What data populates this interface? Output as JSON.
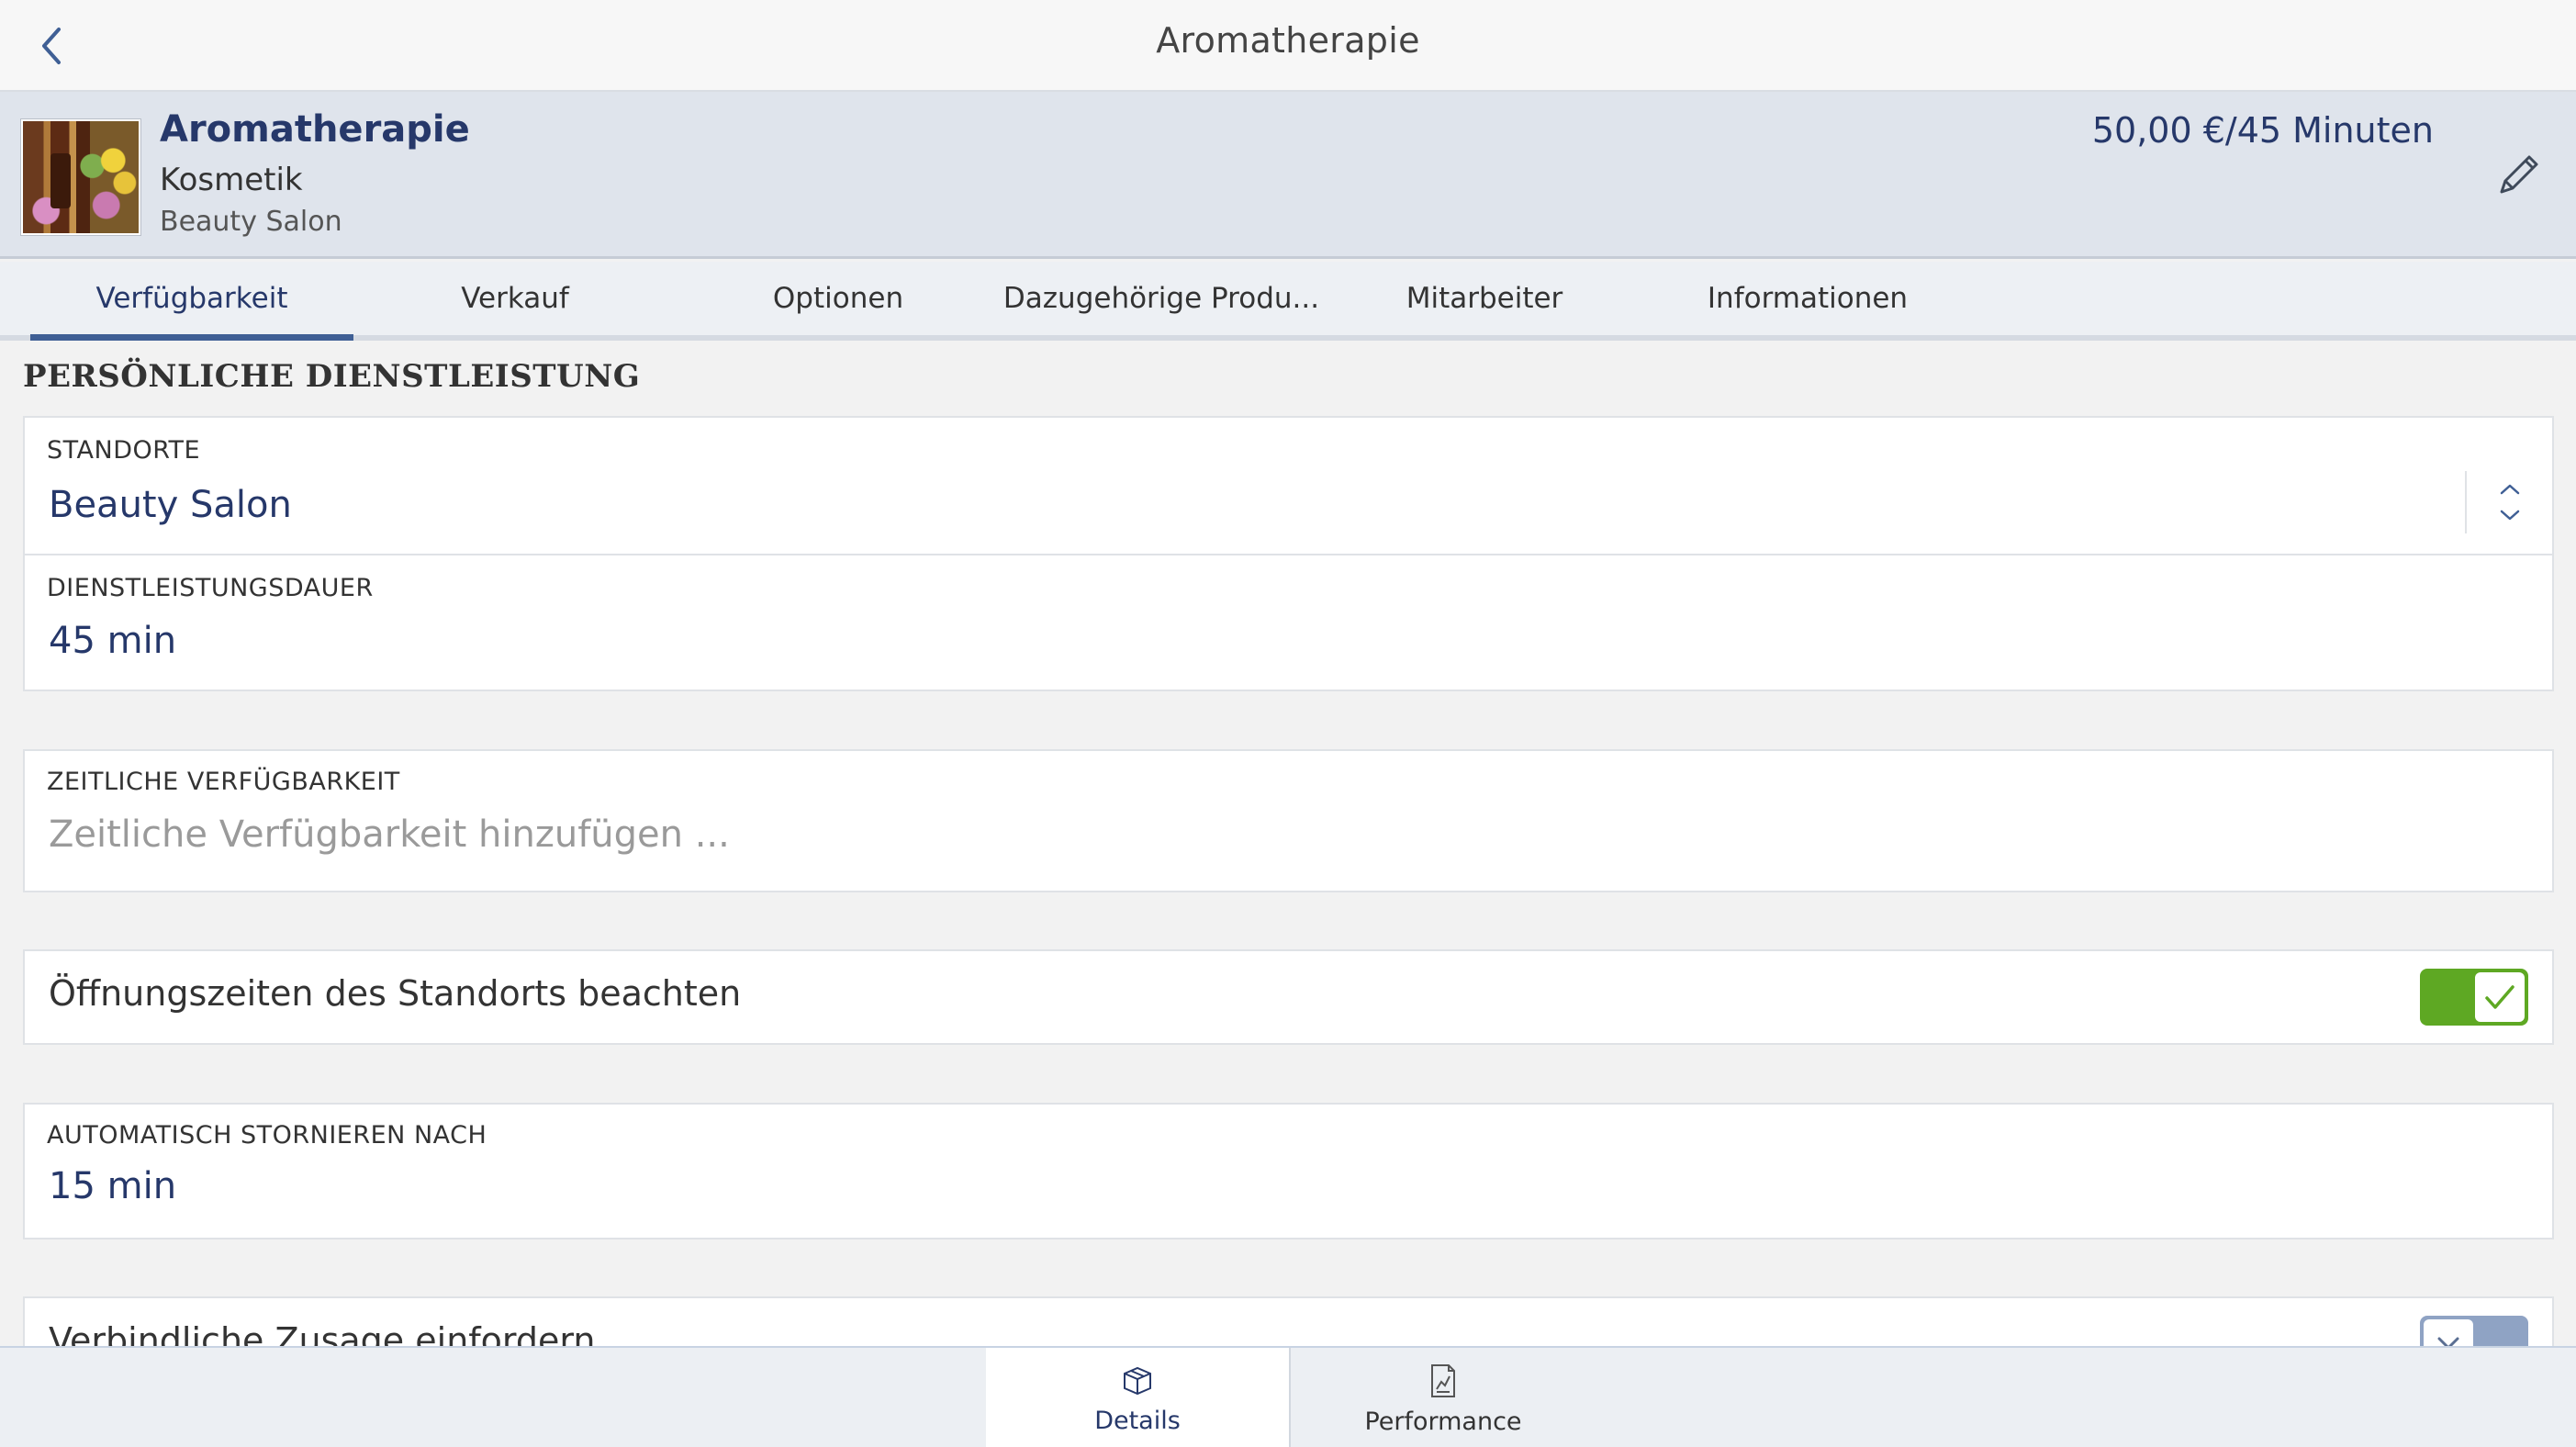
{
  "nav": {
    "title": "Aromatherapie"
  },
  "header": {
    "title": "Aromatherapie",
    "category": "Kosmetik",
    "location": "Beauty Salon",
    "price": "50,00 €/45 Minuten"
  },
  "tabs": [
    {
      "label": "Verfügbarkeit",
      "active": true
    },
    {
      "label": "Verkauf"
    },
    {
      "label": "Optionen"
    },
    {
      "label": "Dazugehörige Produ..."
    },
    {
      "label": "Mitarbeiter"
    },
    {
      "label": "Informationen"
    }
  ],
  "section": {
    "title": "PERSÖNLICHE DIENSTLEISTUNG"
  },
  "fields": {
    "standorte": {
      "label": "STANDORTE",
      "value": "Beauty Salon"
    },
    "dauer": {
      "label": "DIENSTLEISTUNGSDAUER",
      "value": "45 min"
    },
    "zeitlich": {
      "label": "ZEITLICHE VERFÜGBARKEIT",
      "placeholder": "Zeitliche Verfügbarkeit hinzufügen ..."
    },
    "oeffnung": {
      "label": "Öffnungszeiten des Standorts beachten",
      "checked": true
    },
    "storno": {
      "label": "AUTOMATISCH STORNIEREN NACH",
      "value": "15 min"
    },
    "zusage": {
      "label": "Verbindliche Zusage einfordern",
      "checked": false
    }
  },
  "bottom_tabs": [
    {
      "label": "Details",
      "icon": "box-icon",
      "active": true
    },
    {
      "label": "Performance",
      "icon": "chart-document-icon"
    }
  ],
  "colors": {
    "accent": "#26386a",
    "toggle_on": "#5ea823",
    "toggle_off": "#8fa3c4"
  }
}
